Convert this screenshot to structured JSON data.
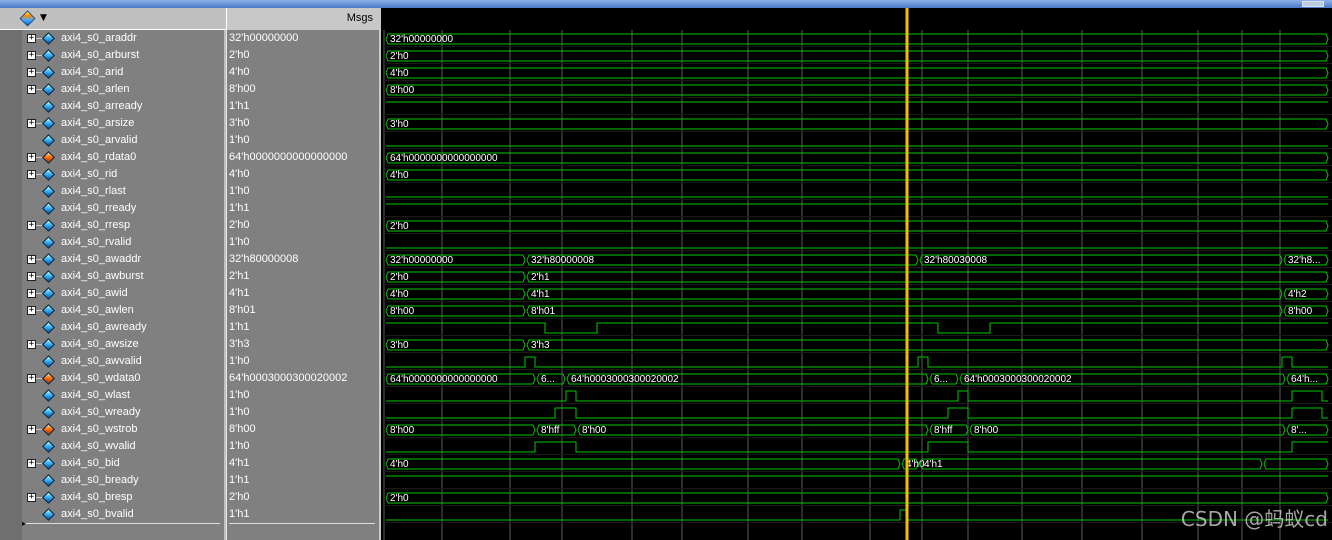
{
  "toolbar": {
    "msgs_label": "Msgs"
  },
  "signals": [
    {
      "name": "axi4_s0_araddr",
      "value": "32'h00000000",
      "expandable": true,
      "icon": "blue",
      "wave": "bus",
      "segs": [
        [
          "32'h00000000"
        ]
      ]
    },
    {
      "name": "axi4_s0_arburst",
      "value": "2'h0",
      "expandable": true,
      "icon": "blue",
      "wave": "bus",
      "segs": [
        [
          "2'h0"
        ]
      ]
    },
    {
      "name": "axi4_s0_arid",
      "value": "4'h0",
      "expandable": true,
      "icon": "blue",
      "wave": "bus",
      "segs": [
        [
          "4'h0"
        ]
      ]
    },
    {
      "name": "axi4_s0_arlen",
      "value": "8'h00",
      "expandable": true,
      "icon": "blue",
      "wave": "bus",
      "segs": [
        [
          "8'h00"
        ]
      ]
    },
    {
      "name": "axi4_s0_arready",
      "value": "1'h1",
      "expandable": false,
      "icon": "blue",
      "wave": "high"
    },
    {
      "name": "axi4_s0_arsize",
      "value": "3'h0",
      "expandable": true,
      "icon": "blue",
      "wave": "bus",
      "segs": [
        [
          "3'h0"
        ]
      ]
    },
    {
      "name": "axi4_s0_arvalid",
      "value": "1'h0",
      "expandable": false,
      "icon": "blue",
      "wave": "low"
    },
    {
      "name": "axi4_s0_rdata0",
      "value": "64'h0000000000000000",
      "expandable": true,
      "icon": "orange",
      "wave": "bus",
      "segs": [
        [
          "64'h0000000000000000"
        ]
      ]
    },
    {
      "name": "axi4_s0_rid",
      "value": "4'h0",
      "expandable": true,
      "icon": "blue",
      "wave": "bus",
      "segs": [
        [
          "4'h0"
        ]
      ]
    },
    {
      "name": "axi4_s0_rlast",
      "value": "1'h0",
      "expandable": false,
      "icon": "blue",
      "wave": "low"
    },
    {
      "name": "axi4_s0_rready",
      "value": "1'h1",
      "expandable": false,
      "icon": "blue",
      "wave": "high"
    },
    {
      "name": "axi4_s0_rresp",
      "value": "2'h0",
      "expandable": true,
      "icon": "blue",
      "wave": "bus",
      "segs": [
        [
          "2'h0"
        ]
      ]
    },
    {
      "name": "axi4_s0_rvalid",
      "value": "1'h0",
      "expandable": false,
      "icon": "blue",
      "wave": "low"
    },
    {
      "name": "axi4_s0_awaddr",
      "value": "32'h80000008",
      "expandable": true,
      "icon": "blue",
      "wave": "bus",
      "segs": [
        [
          "32'h00000000"
        ],
        [
          "32'h80000008"
        ],
        [
          "32'h80030008"
        ],
        [
          "32'h8..."
        ]
      ]
    },
    {
      "name": "axi4_s0_awburst",
      "value": "2'h1",
      "expandable": true,
      "icon": "blue",
      "wave": "bus",
      "segs": [
        [
          "2'h0"
        ],
        [
          "2'h1"
        ]
      ]
    },
    {
      "name": "axi4_s0_awid",
      "value": "4'h1",
      "expandable": true,
      "icon": "blue",
      "wave": "bus",
      "segs": [
        [
          "4'h0"
        ],
        [
          "4'h1"
        ],
        [
          "4'h2"
        ]
      ]
    },
    {
      "name": "axi4_s0_awlen",
      "value": "8'h01",
      "expandable": true,
      "icon": "blue",
      "wave": "bus",
      "segs": [
        [
          "8'h00"
        ],
        [
          "8'h01"
        ],
        [
          "8'h00"
        ]
      ]
    },
    {
      "name": "axi4_s0_awready",
      "value": "1'h1",
      "expandable": false,
      "icon": "blue",
      "wave": "bit"
    },
    {
      "name": "axi4_s0_awsize",
      "value": "3'h3",
      "expandable": true,
      "icon": "blue",
      "wave": "bus",
      "segs": [
        [
          "3'h0"
        ],
        [
          "3'h3"
        ]
      ]
    },
    {
      "name": "axi4_s0_awvalid",
      "value": "1'h0",
      "expandable": false,
      "icon": "blue",
      "wave": "bit"
    },
    {
      "name": "axi4_s0_wdata0",
      "value": "64'h0003000300020002",
      "expandable": true,
      "icon": "orange",
      "wave": "bus",
      "segs": [
        [
          "64'h0000000000000000"
        ],
        [
          "6..."
        ],
        [
          "64'h0003000300020002"
        ],
        [
          "6..."
        ],
        [
          "64'h0003000300020002"
        ],
        [
          "64'h..."
        ]
      ]
    },
    {
      "name": "axi4_s0_wlast",
      "value": "1'h0",
      "expandable": false,
      "icon": "blue",
      "wave": "bit"
    },
    {
      "name": "axi4_s0_wready",
      "value": "1'h0",
      "expandable": false,
      "icon": "blue",
      "wave": "bit"
    },
    {
      "name": "axi4_s0_wstrob",
      "value": "8'h00",
      "expandable": true,
      "icon": "orange",
      "wave": "bus",
      "segs": [
        [
          "8'h00"
        ],
        [
          "8'hff"
        ],
        [
          "8'h00"
        ],
        [
          "8'hff"
        ],
        [
          "8'h00"
        ],
        [
          "8'..."
        ]
      ]
    },
    {
      "name": "axi4_s0_wvalid",
      "value": "1'h0",
      "expandable": false,
      "icon": "blue",
      "wave": "bit"
    },
    {
      "name": "axi4_s0_bid",
      "value": "4'h1",
      "expandable": true,
      "icon": "blue",
      "wave": "bus",
      "segs": [
        [
          "4'h0"
        ],
        [
          "4'h0"
        ],
        [
          "4'h1"
        ]
      ]
    },
    {
      "name": "axi4_s0_bready",
      "value": "1'h1",
      "expandable": false,
      "icon": "blue",
      "wave": "high"
    },
    {
      "name": "axi4_s0_bresp",
      "value": "2'h0",
      "expandable": true,
      "icon": "blue",
      "wave": "bus",
      "segs": [
        [
          "2'h0"
        ]
      ]
    },
    {
      "name": "axi4_s0_bvalid",
      "value": "1'h1",
      "expandable": false,
      "icon": "blue",
      "wave": "bit"
    }
  ],
  "colors": {
    "wave": "#00c800",
    "grid": "#5a5a5a",
    "cursor": "#f0c000",
    "panel": "#808080"
  },
  "watermark": "CSDN @蚂蚁cd"
}
